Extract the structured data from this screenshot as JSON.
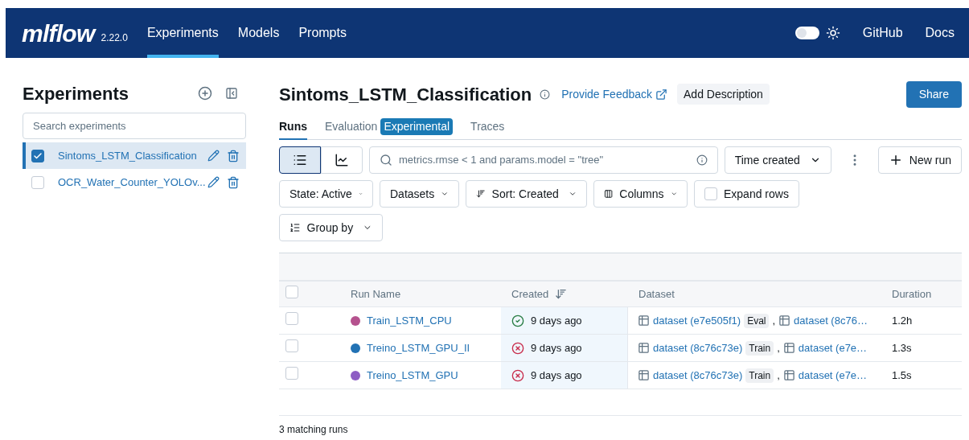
{
  "nav": {
    "logo": "mlflow",
    "version": "2.22.0",
    "links": [
      {
        "label": "Experiments",
        "selected": true
      },
      {
        "label": "Models",
        "selected": false
      },
      {
        "label": "Prompts",
        "selected": false
      }
    ],
    "theme_toggle": {
      "on": false
    },
    "right_links": [
      "GitHub",
      "Docs"
    ]
  },
  "sidebar": {
    "title": "Experiments",
    "search": {
      "placeholder": "Search experiments"
    },
    "items": [
      {
        "name": "Sintoms_LSTM_Classification",
        "selected": true,
        "checked": true
      },
      {
        "name": "OCR_Water_Counter_YOLOv...",
        "selected": false,
        "checked": false
      }
    ]
  },
  "header": {
    "title": "Sintoms_LSTM_Classification",
    "feedback": "Provide Feedback",
    "add_description": "Add Description",
    "share": "Share"
  },
  "tabs": [
    {
      "label": "Runs",
      "selected": true
    },
    {
      "label": "Evaluation",
      "badge": "Experimental",
      "selected": false
    },
    {
      "label": "Traces",
      "selected": false
    }
  ],
  "toolbar": {
    "view_modes": [
      {
        "kind": "table",
        "selected": true
      },
      {
        "kind": "chart",
        "selected": false
      }
    ],
    "search": {
      "placeholder": "metrics.rmse < 1 and params.model = \"tree\""
    },
    "time_filter": "Time created",
    "new_run": "New run",
    "state": "State: Active",
    "datasets": "Datasets",
    "sort": "Sort: Created",
    "columns": "Columns",
    "expand_rows": {
      "label": "Expand rows",
      "checked": false
    },
    "group_by": "Group by"
  },
  "table": {
    "select_all": {
      "checked": false
    },
    "columns": [
      "Run Name",
      "Created",
      "Dataset",
      "Duration"
    ],
    "rows": [
      {
        "checked": false,
        "color": "#b5528e",
        "name": "Train_LSTM_CPU",
        "kind": "success",
        "created": "9 days ago",
        "datasets": [
          {
            "name": "dataset (e7e505f1)",
            "tag": "Eval"
          },
          {
            "separator": ",",
            "name": "dataset (8c76…"
          }
        ],
        "duration": "1.2h"
      },
      {
        "checked": false,
        "color": "#2272b4",
        "name": "Treino_LSTM_GPU_II",
        "kind": "failed",
        "created": "9 days ago",
        "datasets": [
          {
            "name": "dataset (8c76c73e)",
            "tag": "Train"
          },
          {
            "separator": ",",
            "name": "dataset (e7e…"
          }
        ],
        "duration": "1.3s"
      },
      {
        "checked": false,
        "color": "#8e5ec4",
        "name": "Treino_LSTM_GPU",
        "kind": "failed",
        "created": "9 days ago",
        "datasets": [
          {
            "name": "dataset (8c76c73e)",
            "tag": "Train"
          },
          {
            "separator": ",",
            "name": "dataset (e7e…"
          }
        ],
        "duration": "1.5s"
      }
    ]
  },
  "footer": "3 matching runs"
}
